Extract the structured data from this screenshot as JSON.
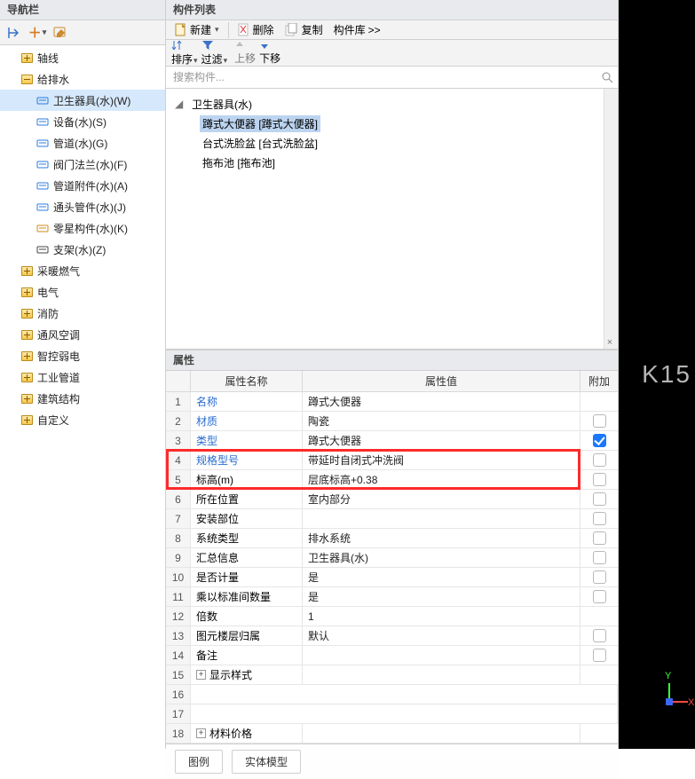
{
  "nav": {
    "title": "导航栏",
    "toolbar": {
      "collapse": "⇤",
      "add": "+",
      "edit": "✎"
    },
    "items": [
      {
        "label": "轴线",
        "expanded": false,
        "selected": false,
        "children": []
      },
      {
        "label": "给排水",
        "expanded": true,
        "selected": false,
        "children": [
          {
            "label": "卫生器具(水)(W)",
            "icon": "fixture-icon",
            "selected": true,
            "color": "#2b7de1"
          },
          {
            "label": "设备(水)(S)",
            "icon": "equipment-icon",
            "selected": false,
            "color": "#2b7de1"
          },
          {
            "label": "管道(水)(G)",
            "icon": "pipe-icon",
            "selected": false,
            "color": "#2b7de1"
          },
          {
            "label": "阀门法兰(水)(F)",
            "icon": "valve-icon",
            "selected": false,
            "color": "#2b7de1"
          },
          {
            "label": "管道附件(水)(A)",
            "icon": "pipe-fitting-icon",
            "selected": false,
            "color": "#2b7de1"
          },
          {
            "label": "通头管件(水)(J)",
            "icon": "connector-icon",
            "selected": false,
            "color": "#2b7de1"
          },
          {
            "label": "零星构件(水)(K)",
            "icon": "misc-icon",
            "selected": false,
            "color": "#d18a1b"
          },
          {
            "label": "支架(水)(Z)",
            "icon": "bracket-icon",
            "selected": false,
            "color": "#444"
          }
        ]
      },
      {
        "label": "采暖燃气",
        "expanded": false,
        "children": []
      },
      {
        "label": "电气",
        "expanded": false,
        "children": []
      },
      {
        "label": "消防",
        "expanded": false,
        "children": []
      },
      {
        "label": "通风空调",
        "expanded": false,
        "children": []
      },
      {
        "label": "智控弱电",
        "expanded": false,
        "children": []
      },
      {
        "label": "工业管道",
        "expanded": false,
        "children": []
      },
      {
        "label": "建筑结构",
        "expanded": false,
        "children": []
      },
      {
        "label": "自定义",
        "expanded": false,
        "children": []
      }
    ]
  },
  "components": {
    "title": "构件列表",
    "toolbar": {
      "new": "新建",
      "delete": "删除",
      "copy": "复制",
      "library": "构件库",
      "more": ">>"
    },
    "sortbar": {
      "sort": "排序",
      "filter": "过滤",
      "up": "上移",
      "down": "下移"
    },
    "search_placeholder": "搜索构件...",
    "tree": {
      "root": "卫生器具(水)",
      "items": [
        {
          "label": "蹲式大便器 [蹲式大便器]",
          "selected": true
        },
        {
          "label": "台式洗脸盆 [台式洗脸盆]",
          "selected": false
        },
        {
          "label": "拖布池 [拖布池]",
          "selected": false
        }
      ]
    }
  },
  "properties": {
    "title": "属性",
    "columns": {
      "num": "",
      "name": "属性名称",
      "value": "属性值",
      "extra": "附加"
    },
    "rows": [
      {
        "n": "1",
        "name": "名称",
        "value": "蹲式大便器",
        "link": true,
        "check": null
      },
      {
        "n": "2",
        "name": "材质",
        "value": "陶瓷",
        "link": true,
        "check": false
      },
      {
        "n": "3",
        "name": "类型",
        "value": "蹲式大便器",
        "link": true,
        "check": true
      },
      {
        "n": "4",
        "name": "规格型号",
        "value": "带延时自闭式冲洗阀",
        "link": true,
        "check": false
      },
      {
        "n": "5",
        "name": "标高(m)",
        "value": "层底标高+0.38",
        "link": false,
        "check": false
      },
      {
        "n": "6",
        "name": "所在位置",
        "value": "室内部分",
        "link": false,
        "check": false
      },
      {
        "n": "7",
        "name": "安装部位",
        "value": "",
        "link": false,
        "check": false
      },
      {
        "n": "8",
        "name": "系统类型",
        "value": "排水系统",
        "link": false,
        "check": false
      },
      {
        "n": "9",
        "name": "汇总信息",
        "value": "卫生器具(水)",
        "link": false,
        "check": false
      },
      {
        "n": "10",
        "name": "是否计量",
        "value": "是",
        "link": false,
        "check": false
      },
      {
        "n": "11",
        "name": "乘以标准间数量",
        "value": "是",
        "link": false,
        "check": false
      },
      {
        "n": "12",
        "name": "倍数",
        "value": "1",
        "link": false,
        "check": null
      },
      {
        "n": "13",
        "name": "图元楼层归属",
        "value": "默认",
        "link": false,
        "check": false
      },
      {
        "n": "14",
        "name": "备注",
        "value": "",
        "link": false,
        "check": false
      },
      {
        "n": "15",
        "name": "显示样式",
        "value": "",
        "link": false,
        "check": null,
        "expandable": true
      },
      {
        "n": "16",
        "name": "",
        "value": "",
        "link": false,
        "check": null,
        "blank": true
      },
      {
        "n": "17",
        "name": "",
        "value": "",
        "link": false,
        "check": null,
        "blank": true
      },
      {
        "n": "18",
        "name": "材料价格",
        "value": "",
        "link": false,
        "check": null,
        "expandable": true
      }
    ],
    "tabs": {
      "legend": "图例",
      "model": "实体模型"
    }
  },
  "viewport": {
    "label": "K15",
    "yaxis": "Y",
    "xaxis": "X"
  },
  "highlight_rows": [
    "4",
    "5"
  ]
}
